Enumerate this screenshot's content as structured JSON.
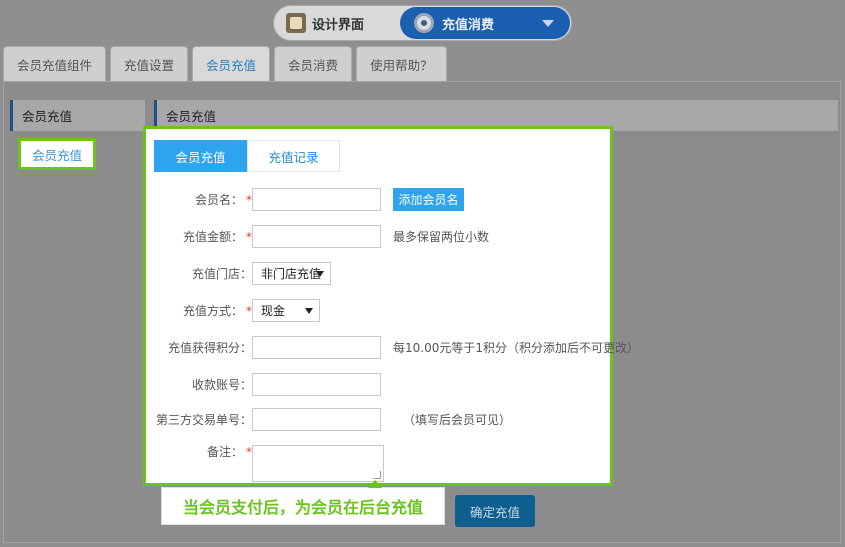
{
  "switcher": {
    "left_label": "设计界面",
    "right_label": "充值消费",
    "left_icon": "design-icon",
    "right_icon": "gear-icon"
  },
  "tabs": [
    {
      "label": "会员充值组件",
      "active": false
    },
    {
      "label": "充值设置",
      "active": false
    },
    {
      "label": "会员充值",
      "active": true
    },
    {
      "label": "会员消费",
      "active": false
    },
    {
      "label": "使用帮助？",
      "active": false
    }
  ],
  "sidebar": {
    "header": "会员充值",
    "items": [
      {
        "label": "会员充值"
      }
    ]
  },
  "main": {
    "header": "会员充值",
    "panel_tabs": [
      {
        "label": "会员充值",
        "active": true
      },
      {
        "label": "充值记录",
        "active": false
      }
    ],
    "form": {
      "member_name": {
        "label": "会员名：",
        "required_mark": "*",
        "value": "",
        "add_button": "添加会员名"
      },
      "amount": {
        "label": "充值金额：",
        "required_mark": "*",
        "value": "",
        "hint": "最多保留两位小数"
      },
      "store": {
        "label": "充值门店：",
        "selected": "非门店充值"
      },
      "method": {
        "label": "充值方式：",
        "required_mark": "*",
        "selected": "现金"
      },
      "points": {
        "label": "充值获得积分：",
        "value": "",
        "hint": "每10.00元等于1积分（积分添加后不可更改）"
      },
      "account": {
        "label": "收款账号：",
        "value": ""
      },
      "third_party": {
        "label": "第三方交易单号：",
        "value": "",
        "hint": "（填写后会员可见）"
      },
      "remark": {
        "label": "备注：",
        "required_mark": "*",
        "value": ""
      }
    },
    "submit_label": "确定充值"
  },
  "callout": {
    "text": "当会员支付后，为会员在后台充值"
  },
  "colors": {
    "highlight": "#6bc41e",
    "accent_blue": "#2ea3ee",
    "required": "#e03a3a"
  }
}
